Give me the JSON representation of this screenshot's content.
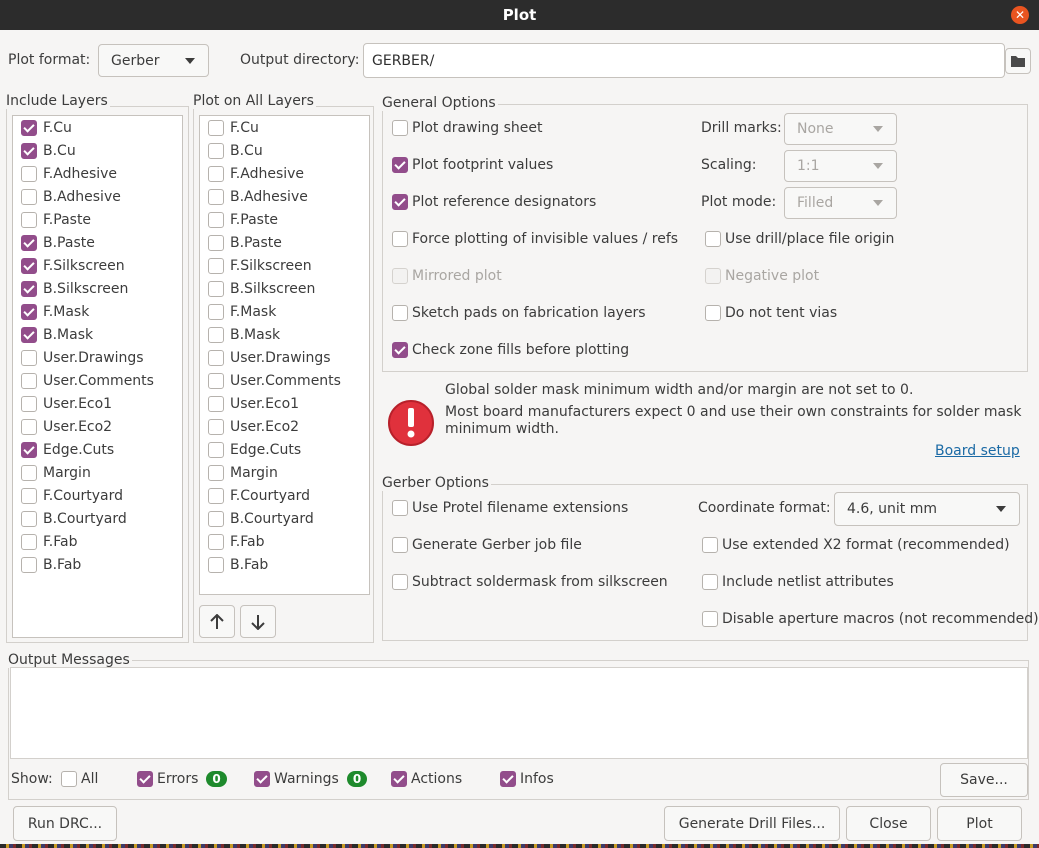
{
  "window": {
    "title": "Plot"
  },
  "top": {
    "plot_format_label": "Plot format:",
    "plot_format_value": "Gerber",
    "output_dir_label": "Output directory:",
    "output_dir_value": "GERBER/"
  },
  "include_layers": {
    "title": "Include Layers",
    "items": [
      {
        "label": "F.Cu",
        "checked": true
      },
      {
        "label": "B.Cu",
        "checked": true
      },
      {
        "label": "F.Adhesive",
        "checked": false
      },
      {
        "label": "B.Adhesive",
        "checked": false
      },
      {
        "label": "F.Paste",
        "checked": false
      },
      {
        "label": "B.Paste",
        "checked": true
      },
      {
        "label": "F.Silkscreen",
        "checked": true
      },
      {
        "label": "B.Silkscreen",
        "checked": true
      },
      {
        "label": "F.Mask",
        "checked": true
      },
      {
        "label": "B.Mask",
        "checked": true
      },
      {
        "label": "User.Drawings",
        "checked": false
      },
      {
        "label": "User.Comments",
        "checked": false
      },
      {
        "label": "User.Eco1",
        "checked": false
      },
      {
        "label": "User.Eco2",
        "checked": false
      },
      {
        "label": "Edge.Cuts",
        "checked": true
      },
      {
        "label": "Margin",
        "checked": false
      },
      {
        "label": "F.Courtyard",
        "checked": false
      },
      {
        "label": "B.Courtyard",
        "checked": false
      },
      {
        "label": "F.Fab",
        "checked": false
      },
      {
        "label": "B.Fab",
        "checked": false
      }
    ]
  },
  "plot_all_layers": {
    "title": "Plot on All Layers",
    "items": [
      {
        "label": "F.Cu",
        "checked": false
      },
      {
        "label": "B.Cu",
        "checked": false
      },
      {
        "label": "F.Adhesive",
        "checked": false
      },
      {
        "label": "B.Adhesive",
        "checked": false
      },
      {
        "label": "F.Paste",
        "checked": false
      },
      {
        "label": "B.Paste",
        "checked": false
      },
      {
        "label": "F.Silkscreen",
        "checked": false
      },
      {
        "label": "B.Silkscreen",
        "checked": false
      },
      {
        "label": "F.Mask",
        "checked": false
      },
      {
        "label": "B.Mask",
        "checked": false
      },
      {
        "label": "User.Drawings",
        "checked": false
      },
      {
        "label": "User.Comments",
        "checked": false
      },
      {
        "label": "User.Eco1",
        "checked": false
      },
      {
        "label": "User.Eco2",
        "checked": false
      },
      {
        "label": "Edge.Cuts",
        "checked": false
      },
      {
        "label": "Margin",
        "checked": false
      },
      {
        "label": "F.Courtyard",
        "checked": false
      },
      {
        "label": "B.Courtyard",
        "checked": false
      },
      {
        "label": "F.Fab",
        "checked": false
      },
      {
        "label": "B.Fab",
        "checked": false
      }
    ],
    "up_icon": "arrow-up-icon",
    "down_icon": "arrow-down-icon"
  },
  "general": {
    "title": "General Options",
    "left": [
      {
        "label": "Plot drawing sheet",
        "checked": false,
        "disabled": false
      },
      {
        "label": "Plot footprint values",
        "checked": true,
        "disabled": false
      },
      {
        "label": "Plot reference designators",
        "checked": true,
        "disabled": false
      },
      {
        "label": "Force plotting of invisible values / refs",
        "checked": false,
        "disabled": false
      },
      {
        "label": "Mirrored plot",
        "checked": false,
        "disabled": true
      },
      {
        "label": "Sketch pads on fabrication layers",
        "checked": false,
        "disabled": false
      },
      {
        "label": "Check zone fills before plotting",
        "checked": true,
        "disabled": false
      }
    ],
    "drill_marks_label": "Drill marks:",
    "drill_marks_value": "None",
    "scaling_label": "Scaling:",
    "scaling_value": "1:1",
    "plot_mode_label": "Plot mode:",
    "plot_mode_value": "Filled",
    "right": [
      {
        "label": "Use drill/place file origin",
        "checked": false,
        "disabled": false
      },
      {
        "label": "Negative plot",
        "checked": false,
        "disabled": true
      },
      {
        "label": "Do not tent vias",
        "checked": false,
        "disabled": false
      }
    ]
  },
  "warning": {
    "icon": "error-icon",
    "line1": "Global solder mask minimum width and/or margin are not set to 0.",
    "line2": "Most board manufacturers expect 0 and use their own constraints for solder mask",
    "line3": "minimum width.",
    "link": "Board setup",
    "color": "#e0313c"
  },
  "gerber": {
    "title": "Gerber Options",
    "left": [
      {
        "label": "Use Protel filename extensions",
        "checked": false
      },
      {
        "label": "Generate Gerber job file",
        "checked": false
      },
      {
        "label": "Subtract soldermask from silkscreen",
        "checked": false
      }
    ],
    "coord_label": "Coordinate format:",
    "coord_value": "4.6, unit mm",
    "right": [
      {
        "label": "Use extended X2 format (recommended)",
        "checked": false
      },
      {
        "label": "Include netlist attributes",
        "checked": false
      },
      {
        "label": "Disable aperture macros (not recommended)",
        "checked": false
      }
    ]
  },
  "messages": {
    "title": "Output Messages",
    "show_label": "Show:",
    "all_label": "All",
    "all_checked": false,
    "errors_label": "Errors",
    "errors_count": "0",
    "errors_checked": true,
    "warnings_label": "Warnings",
    "warnings_count": "0",
    "warnings_checked": true,
    "actions_label": "Actions",
    "actions_checked": true,
    "infos_label": "Infos",
    "infos_checked": true,
    "save_label": "Save..."
  },
  "buttons": {
    "run_drc": "Run DRC...",
    "gen_drill": "Generate Drill Files...",
    "close": "Close",
    "plot": "Plot"
  },
  "colors": {
    "accent": "#924d8b",
    "badge": "#1e8a2c",
    "titlebar": "#2c2c2c",
    "close_button": "#e95420"
  }
}
